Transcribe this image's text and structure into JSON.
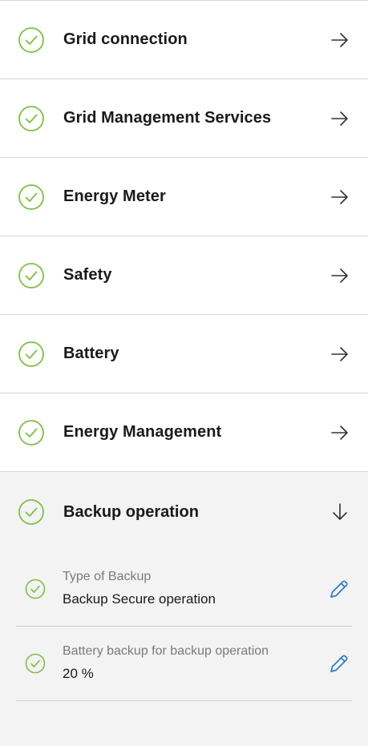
{
  "colors": {
    "check": "#7cc142",
    "edit": "#2a7bc4",
    "arrow": "#333333"
  },
  "sections": [
    {
      "label": "Grid connection",
      "status_icon": "check-circle-icon",
      "action_icon": "arrow-right-icon"
    },
    {
      "label": "Grid Management Services",
      "status_icon": "check-circle-icon",
      "action_icon": "arrow-right-icon"
    },
    {
      "label": "Energy Meter",
      "status_icon": "check-circle-icon",
      "action_icon": "arrow-right-icon"
    },
    {
      "label": "Safety",
      "status_icon": "check-circle-icon",
      "action_icon": "arrow-right-icon"
    },
    {
      "label": "Battery",
      "status_icon": "check-circle-icon",
      "action_icon": "arrow-right-icon"
    },
    {
      "label": "Energy Management",
      "status_icon": "check-circle-icon",
      "action_icon": "arrow-right-icon"
    }
  ],
  "expanded": {
    "label": "Backup operation",
    "status_icon": "check-circle-icon",
    "action_icon": "arrow-down-icon",
    "items": [
      {
        "label": "Type of Backup",
        "value": "Backup Secure operation",
        "edit_icon": "pencil-icon"
      },
      {
        "label": "Battery backup for backup operation",
        "value": "20 %",
        "edit_icon": "pencil-icon"
      }
    ]
  }
}
